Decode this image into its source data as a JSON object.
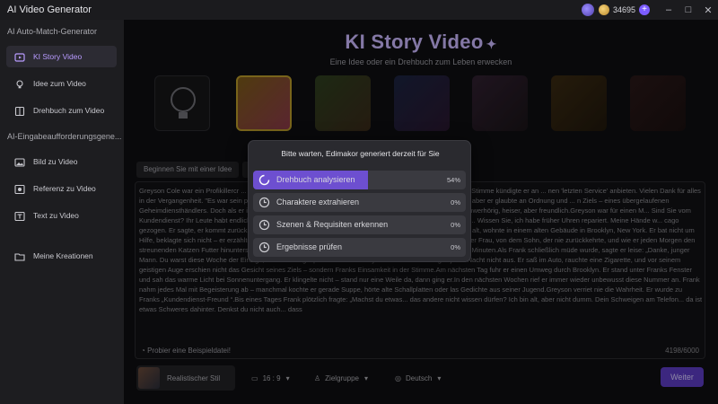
{
  "window": {
    "title": "AI Video Generator",
    "credits": "34695",
    "plus_glyph": "+",
    "minimize_glyph": "–",
    "maximize_glyph": "□",
    "close_glyph": "✕"
  },
  "sidebar": {
    "section1": "AI Auto-Match-Generator",
    "section2": "AI-Eingabeaufforderungsgene...",
    "items": [
      {
        "label": "KI Story Video",
        "icon": "story-video-icon",
        "active": true
      },
      {
        "label": "Idee zum Video",
        "icon": "lightbulb-icon"
      },
      {
        "label": "Drehbuch zum Video",
        "icon": "script-icon"
      },
      {
        "label": "Bild zu Video",
        "icon": "image-icon"
      },
      {
        "label": "Referenz zu Video",
        "icon": "reference-icon"
      },
      {
        "label": "Text zu Video",
        "icon": "text-icon"
      },
      {
        "label": "Meine Kreationen",
        "icon": "folder-icon"
      }
    ]
  },
  "main": {
    "hero_title": "KI Story Video",
    "hero_subtitle": "Eine Idee oder ein Drehbuch zum Leben erwecken",
    "tabs": [
      "Beginnen Sie mit einer Idee",
      "E"
    ],
    "story_text": "Greyson Cole war ein Profikillercr ... ief er sein Ziel mit einer Art „Kundendienst “-Anruf an. Mit ruhiger, höflicher Stimme kündigte er an ... nen 'letzten Service' anbieten. Vielen Dank für alles in der Vergangenheit. \"Es war sein persö... oder ein Priester, der vor der Predigt betet. Er glaubte nicht an Gott, aber er glaubte an Ordnung und ... n Ziels – eines übergelaufenen Geheimdiensthändlers. Doch als er in einer Gasse lauerte, drückte er v... ist da?\" Eine ältere Stimme, etwas schwerhörig, heiser, aber freundlich.Greyson war für einen M... Sind Sie vom Kundendienst? Ihr Leute habt endlich zurückgerufen! Ich will mich nicht ... fünf Jahren allein in dieser Wohnung... Wissen Sie, ich habe früher Uhren repariert. Meine Hände w... cago gezogen. Er sagte, er kommt zurück... kam aber nie. \"Greyson hielt das Telefon. Seine Hand, die ... n, 82 Jahre alt, wohnte in einem alten Gebäude in Brooklyn, New York. Er bat nicht um Hilfe, beklagte sich nicht – er erzählte einfach weiter von seiner Jugend, von der Einsamkeit nach dem Tod seiner Frau, von dem Sohn, der nie zurückkehrte, und wie er jeden Morgen den streunenden Katzen Futter hinunterstellte.Der Killer sagte kein Wort. Er hörte nur zu. Das Gespräch dauerte 47 Minuten.Als Frank schließlich müde wurde, sagte er leise: „Danke, junger Mann. Du warst diese Woche der Einzige, mit dem ich gesprochen habe. \"Greyson führte den Auftrag in jener Nacht nicht aus. Er saß im Auto, rauchte eine Zigarette, und vor seinem geistigen Auge erschien nicht das Gesicht seines Ziels – sondern Franks Einsamkeit in der Stimme.Am nächsten Tag fuhr er einen Umweg durch Brooklyn. Er stand unter Franks Fenster und sah das warme Licht bei Sonnenuntergang. Er klingelte nicht – stand nur eine Weile da, dann ging er.In den nächsten Wochen rief er immer wieder unbewusst diese Nummer an. Frank nahm jedes Mal mit Begeisterung ab – manchmal kochte er gerade Suppe, hörte alte Schallplatten oder las Gedichte aus seiner Jugend.Greyson verriet nie die Wahrheit. Er wurde zu Franks „Kundendienst-Freund “.Bis eines Tages Frank plötzlich fragte: „Machst du etwas... das andere nicht wissen dürfen? Ich bin alt, aber nicht dumm. Dein Schweigen am Telefon... da ist etwas Schweres dahinter. Denkst du nicht auch... dass",
    "sample_link": "Probier eine Beispieldatei!",
    "char_count": "4198/6000",
    "style_label": "Realistischer Stil",
    "aspect": "16 : 9",
    "audience": "Zielgruppe",
    "language": "Deutsch",
    "next_label": "Weiter",
    "thumb_labels": [
      "",
      "",
      "",
      "",
      "",
      "",
      "",
      ""
    ]
  },
  "modal": {
    "title": "Bitte warten, Edimakor generiert derzeit für Sie",
    "steps": [
      {
        "label": "Drehbuch analysieren",
        "percent": "54%",
        "progress": 0.54,
        "icon": "loading-icon"
      },
      {
        "label": "Charaktere extrahieren",
        "percent": "0%",
        "progress": 0,
        "icon": "clock-icon"
      },
      {
        "label": "Szenen & Requisiten erkennen",
        "percent": "0%",
        "progress": 0,
        "icon": "clock-icon"
      },
      {
        "label": "Ergebnisse prüfen",
        "percent": "0%",
        "progress": 0,
        "icon": "clock-icon"
      }
    ]
  },
  "colors": {
    "accent": "#6d4fd0",
    "hero": "#cbb9ff",
    "active_nav": "#b89bff"
  }
}
